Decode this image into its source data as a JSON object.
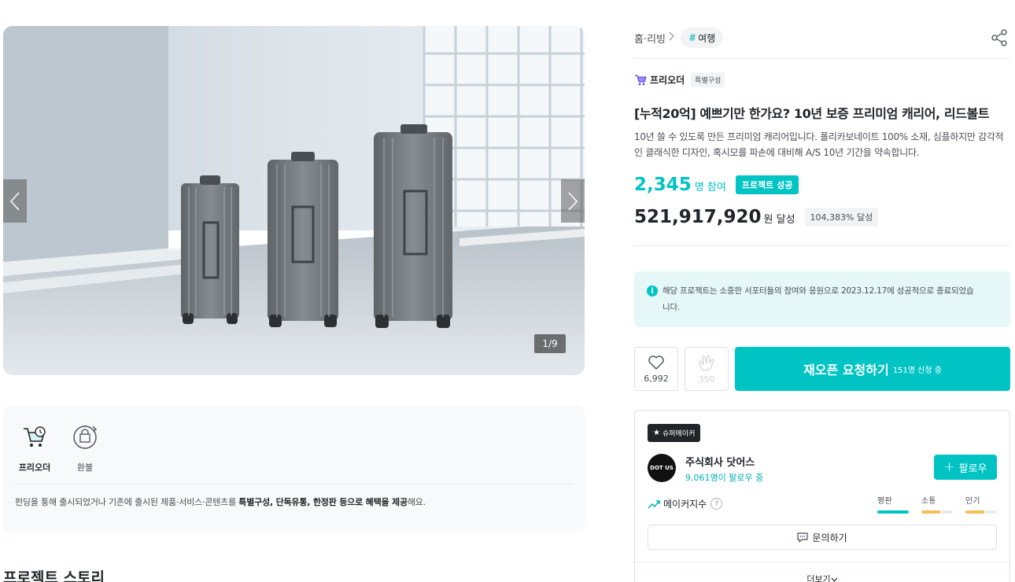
{
  "gallery": {
    "counter": "1/9",
    "prev_icon": "chevron-left-icon",
    "next_icon": "chevron-right-icon"
  },
  "benefits": {
    "items": [
      {
        "label": "프리오더",
        "icon": "cart-clock-icon"
      },
      {
        "label": "환불",
        "icon": "refund-icon"
      }
    ],
    "desc_prefix": "펀딩을 통해 출시되었거나 기존에 출시된 제품·서비스·콘텐츠를 ",
    "desc_bold1": "특별구성, 단독유통, 한정판 등으로 혜택을 제공",
    "desc_suffix": "해요."
  },
  "story_title": "프로젝트 스토리",
  "header": {
    "breadcrumb": "홈·리빙",
    "tag": "여행",
    "tag_hash": "#",
    "share_icon": "share-icon"
  },
  "category": {
    "name": "프리오더",
    "badge": "특별구성"
  },
  "project": {
    "title": "[누적20억] 예쁘기만 한가요? 10년 보증 프리미엄 캐리어, 리드볼트",
    "summary": "10년 쓸 수 있도록 만든 프리미엄 캐리어입니다. 폴리카보네이트 100% 소재, 심플하지만 감각적인 클래식한 디자인, 혹시모를 파손에 대비해 A/S 10년 기간을 약속합니다.",
    "supporters": "2,345",
    "supporters_unit": "명 참여",
    "success_badge": "프로젝트 성공",
    "amount": "521,917,920",
    "amount_unit": "원 달성",
    "rate": "104,383% 달성"
  },
  "notice": {
    "icon": "info-icon",
    "text": "해당 프로젝트는 소중한 서포터들의 참여와 응원으로 2023.12.17에 성공적으로 종료되었습니다."
  },
  "actions": {
    "like_count": "6,992",
    "cheer_count": "350",
    "reopen_label": "재오픈 요청하기",
    "reopen_sub": "151명 신청 중"
  },
  "maker": {
    "badge": "슈퍼메이커",
    "avatar_text": "DOT US",
    "name": "주식회사 닷어스",
    "followers": "9,061명이 팔로우 중",
    "follow_label": "팔로우",
    "index_label": "메이커지수",
    "metrics": [
      {
        "label": "평판",
        "value": 1.0,
        "color": "#00c4c4"
      },
      {
        "label": "소통",
        "value": 0.6,
        "color": "#f7be55"
      },
      {
        "label": "인기",
        "value": 0.6,
        "color": "#f7be55"
      }
    ],
    "inquiry_label": "문의하기",
    "more_label": "더보기"
  }
}
